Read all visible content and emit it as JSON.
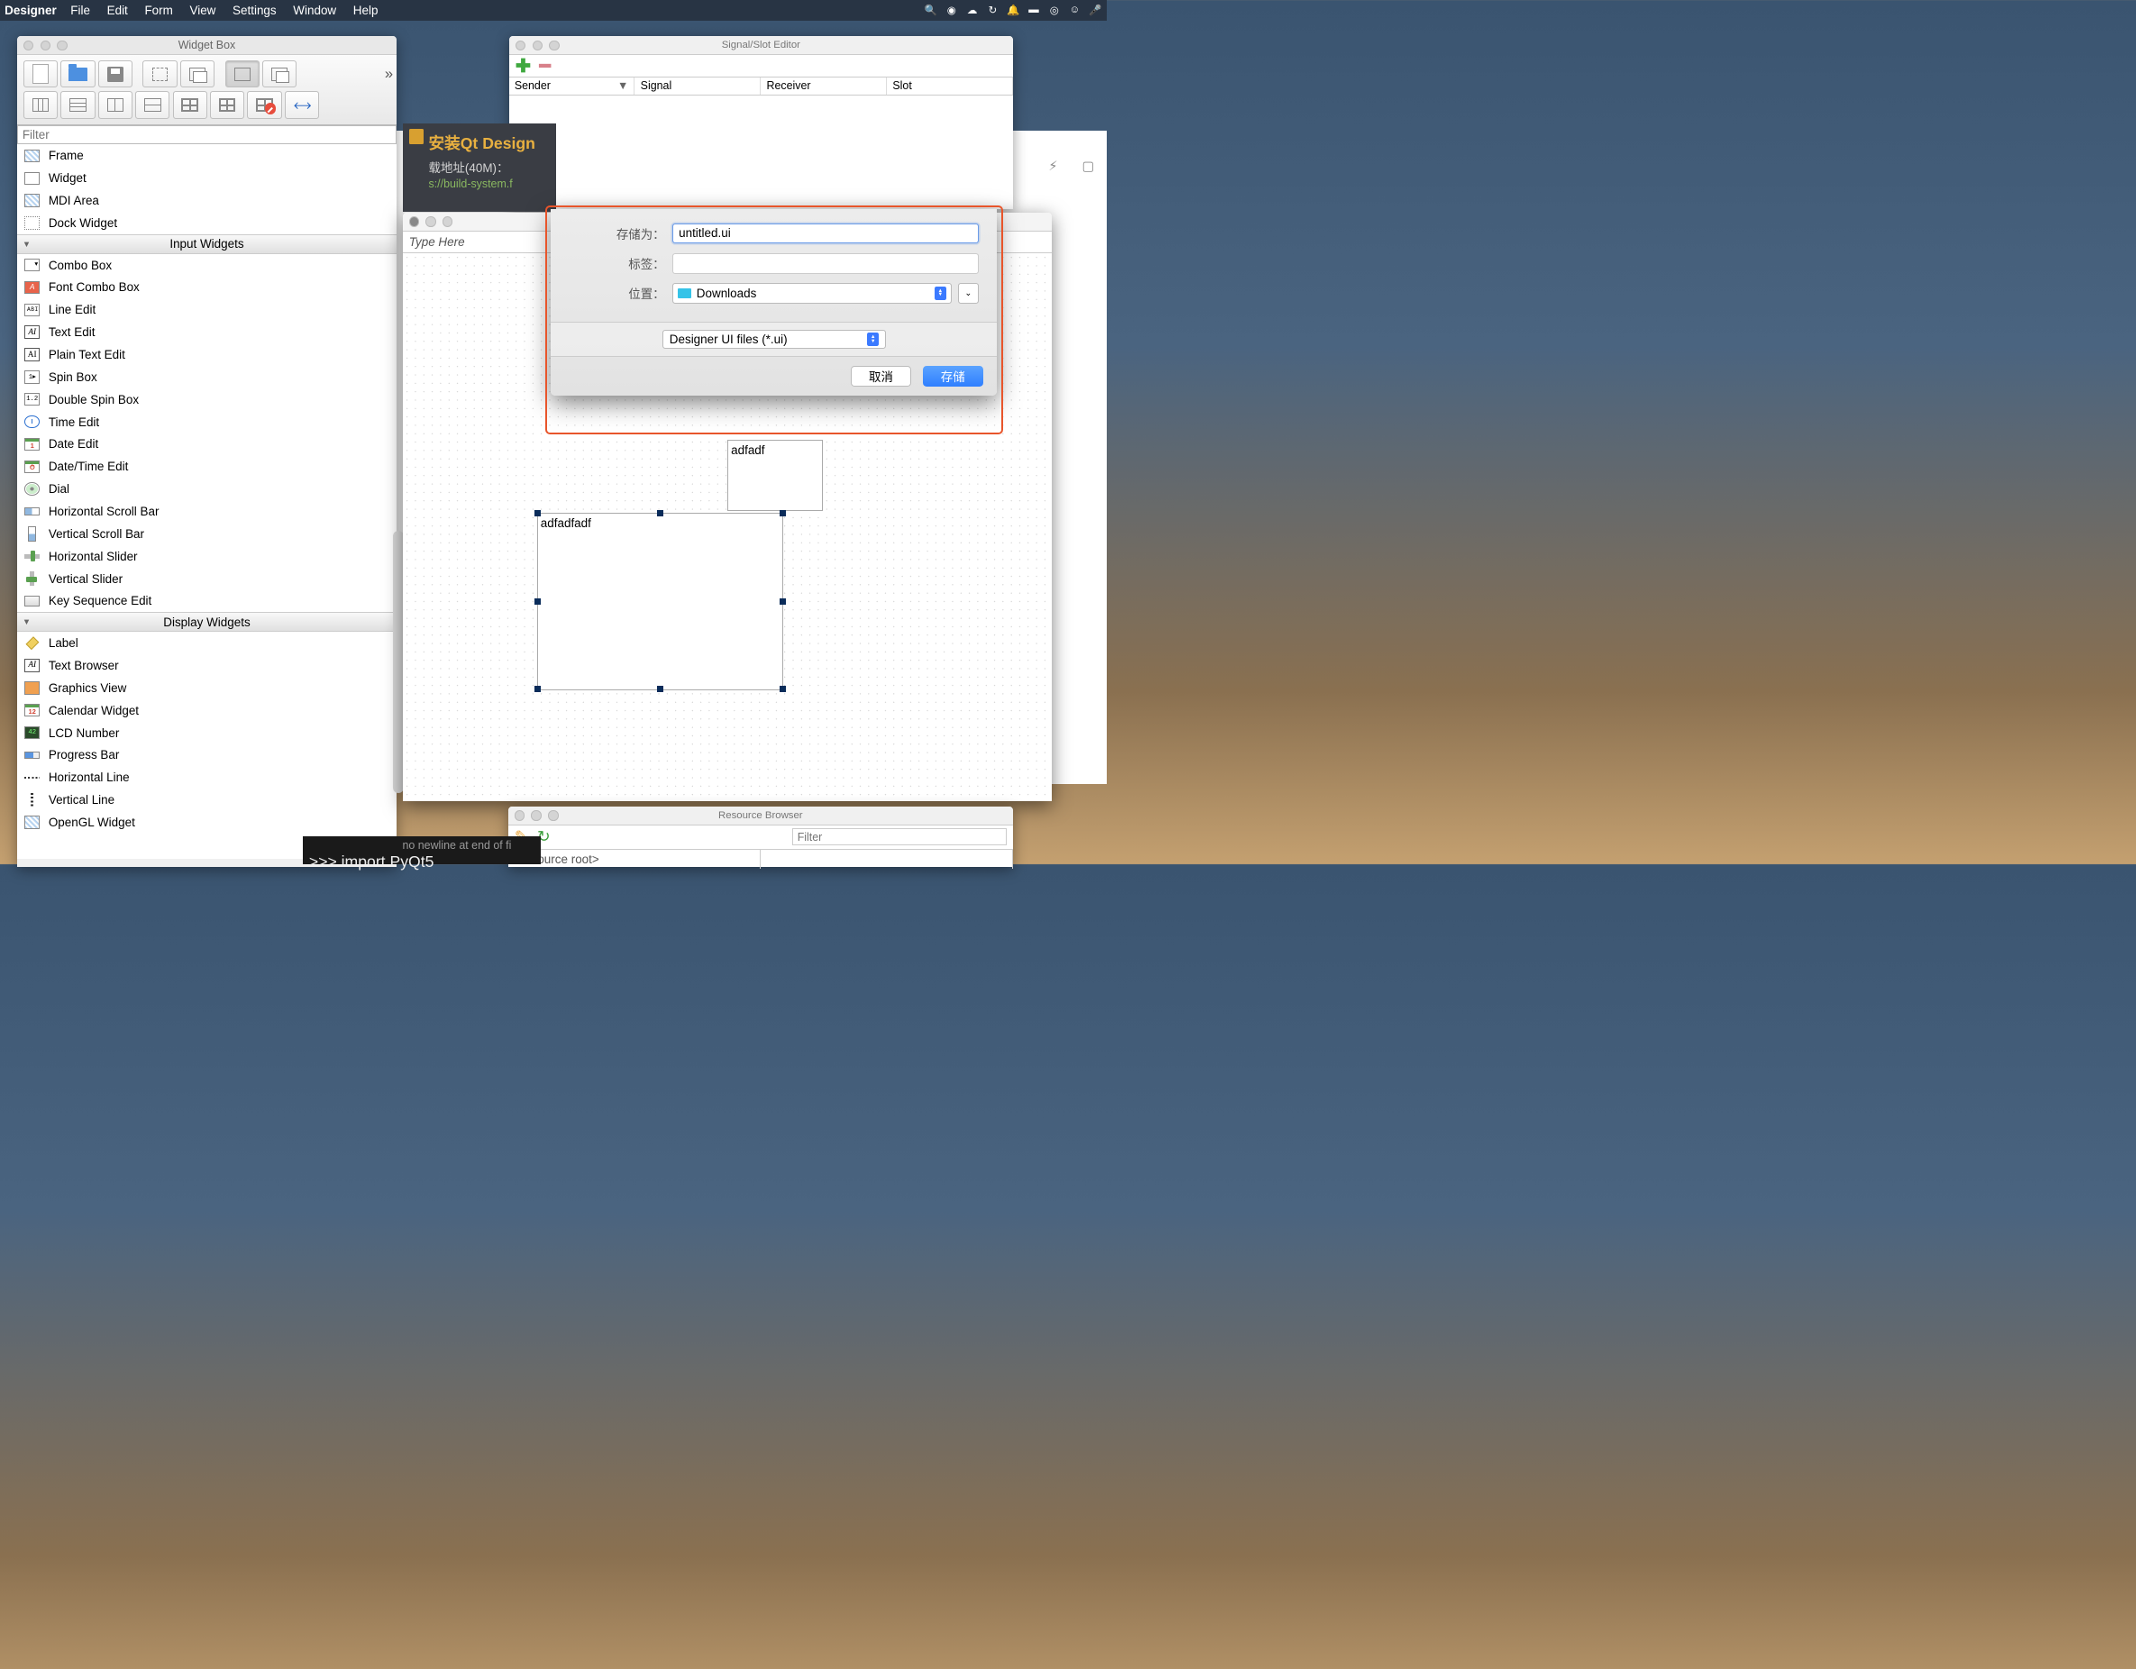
{
  "menubar": {
    "app": "Designer",
    "items": [
      "File",
      "Edit",
      "Form",
      "View",
      "Settings",
      "Window",
      "Help"
    ]
  },
  "widgetbox": {
    "title": "Widget Box",
    "filter_placeholder": "Filter",
    "containers_items": [
      {
        "label": "Frame"
      },
      {
        "label": "Widget"
      },
      {
        "label": "MDI Area"
      },
      {
        "label": "Dock Widget"
      }
    ],
    "sections": [
      {
        "name": "Input Widgets",
        "items": [
          {
            "label": "Combo Box"
          },
          {
            "label": "Font Combo Box"
          },
          {
            "label": "Line Edit"
          },
          {
            "label": "Text Edit"
          },
          {
            "label": "Plain Text Edit"
          },
          {
            "label": "Spin Box"
          },
          {
            "label": "Double Spin Box"
          },
          {
            "label": "Time Edit"
          },
          {
            "label": "Date Edit"
          },
          {
            "label": "Date/Time Edit"
          },
          {
            "label": "Dial"
          },
          {
            "label": "Horizontal Scroll Bar"
          },
          {
            "label": "Vertical Scroll Bar"
          },
          {
            "label": "Horizontal Slider"
          },
          {
            "label": "Vertical Slider"
          },
          {
            "label": "Key Sequence Edit"
          }
        ]
      },
      {
        "name": "Display Widgets",
        "items": [
          {
            "label": "Label"
          },
          {
            "label": "Text Browser"
          },
          {
            "label": "Graphics View"
          },
          {
            "label": "Calendar Widget"
          },
          {
            "label": "LCD Number"
          },
          {
            "label": "Progress Bar"
          },
          {
            "label": "Horizontal Line"
          },
          {
            "label": "Vertical Line"
          },
          {
            "label": "OpenGL Widget"
          }
        ]
      }
    ]
  },
  "signalslot": {
    "title": "Signal/Slot Editor",
    "columns": [
      "Sender",
      "Signal",
      "Receiver",
      "Slot"
    ]
  },
  "form": {
    "menubar_placeholder": "Type Here",
    "widgets": [
      {
        "text": "adfadf"
      },
      {
        "text": "adfadfadf"
      }
    ]
  },
  "save_dialog": {
    "saveas_label": "存储为：",
    "filename": "untitled.ui",
    "tags_label": "标签：",
    "tags_value": "",
    "location_label": "位置：",
    "location_value": "Downloads",
    "filetype": "Designer UI files (*.ui)",
    "cancel": "取消",
    "save": "存储"
  },
  "resource_browser": {
    "title": "Resource Browser",
    "filter_placeholder": "Filter",
    "root_label": "<resource root>"
  },
  "background": {
    "doc_title": "安装Qt Design",
    "doc_sub": "载地址(40M)：",
    "doc_link": "s://build-system.f",
    "newline_msg": "no newline at end of fi",
    "terminal": ">>> import PyQt5"
  }
}
